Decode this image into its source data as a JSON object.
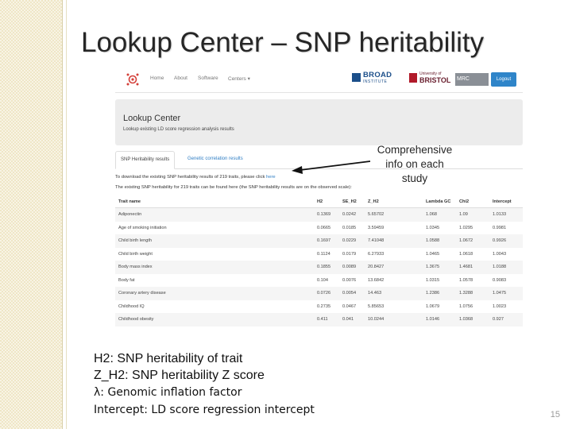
{
  "slide": {
    "title": "Lookup Center – SNP heritability",
    "annotation": [
      "Comprehensive",
      "info on each",
      "study"
    ],
    "definitions": [
      "H2: SNP heritability of trait",
      "Z_H2: SNP heritability Z score",
      "λ: Genomic inflation factor",
      "Intercept: LD score regression intercept"
    ],
    "page_number": "15"
  },
  "navbar": {
    "items": [
      "Home",
      "About",
      "Software",
      "Centers ▾"
    ],
    "broad_name": "BROAD",
    "broad_sub": "INSTITUTE",
    "bristol_small": "University of",
    "bristol_big": "BRISTOL",
    "mrc": "MRC",
    "logout": "Logout"
  },
  "jumbotron": {
    "title": "Lookup Center",
    "subtitle": "Lookup existing LD score regression analysis results"
  },
  "tabs": [
    "SNP Heritability results",
    "Genetic correlation results"
  ],
  "info": {
    "download_text": "To download the existing SNP heritability results of 219 traits, please click ",
    "download_link": "here",
    "note_text": "The existing SNP heritability for 219 traits can be found here (the SNP heritability results are on the observed scale):"
  },
  "table": {
    "columns": [
      "Trait name",
      "H2",
      "SE_H2",
      "Z_H2",
      "Lambda GC",
      "Chi2",
      "Intercept"
    ],
    "rows": [
      [
        "Adiponectin",
        "0.1369",
        "0.0242",
        "5.65702",
        "1.068",
        "1.09",
        "1.0133"
      ],
      [
        "Age of smoking initiation",
        "0.0665",
        "0.0185",
        "3.59459",
        "1.0345",
        "1.0295",
        "0.9981"
      ],
      [
        "Child birth length",
        "0.1697",
        "0.0229",
        "7.41048",
        "1.0588",
        "1.0672",
        "0.9926"
      ],
      [
        "Child birth weight",
        "0.1124",
        "0.0179",
        "6.27933",
        "1.0465",
        "1.0618",
        "1.0043"
      ],
      [
        "Body mass index",
        "0.1855",
        "0.0089",
        "20.8427",
        "1.3675",
        "1.4681",
        "1.0188"
      ],
      [
        "Body fat",
        "0.104",
        "0.0076",
        "13.6842",
        "1.0315",
        "1.0578",
        "0.9083"
      ],
      [
        "Coronary artery disease",
        "0.0726",
        "0.0054",
        "14.463",
        "1.2386",
        "1.3288",
        "1.0475"
      ],
      [
        "Childhood IQ",
        "0.2735",
        "0.0467",
        "5.85653",
        "1.0679",
        "1.0756",
        "1.0023"
      ],
      [
        "Childhood obesity",
        "0.411",
        "0.041",
        "10.0244",
        "1.0146",
        "1.0368",
        "0.927"
      ]
    ]
  }
}
